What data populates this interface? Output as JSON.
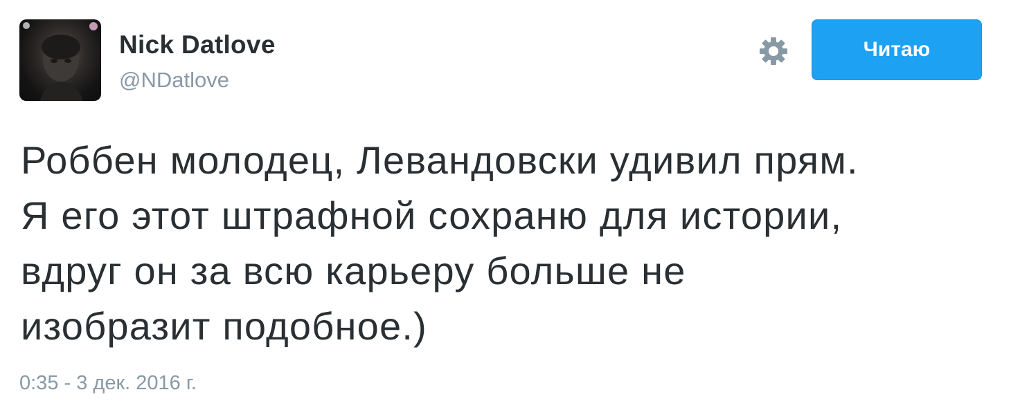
{
  "user": {
    "display_name": "Nick Datlove",
    "screen_name": "@NDatlove"
  },
  "follow_button": {
    "label": "Читаю"
  },
  "settings": {
    "icon": "gear-icon"
  },
  "tweet": {
    "lines": [
      "Роббен молодец, Левандовски удивил прям.",
      "Я его этот штрафной сохраню для истории,",
      "вдруг он за всю карьеру больше не",
      "изобразит подобное.)"
    ],
    "timestamp": "0:35 - 3 дек. 2016 г."
  },
  "colors": {
    "text": "#292f33",
    "secondary_text": "#8899a6",
    "follow_button_bg": "#1da1f2",
    "gear": "#8899a6"
  }
}
